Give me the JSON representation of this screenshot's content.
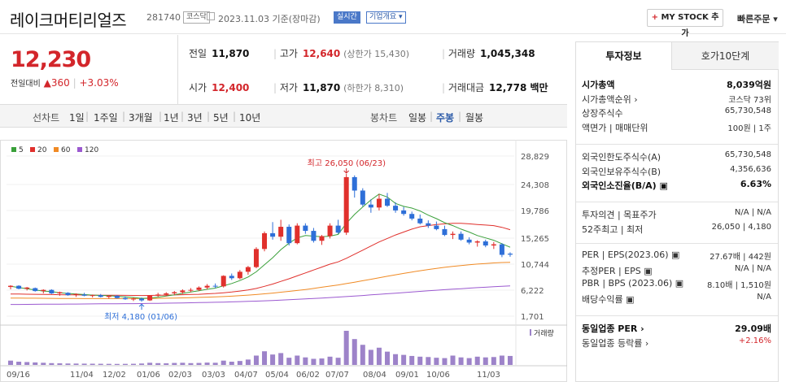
{
  "header": {
    "name": "레이크머티리얼즈",
    "code": "281740",
    "market": "코스닥",
    "date": "2023.11.03 기준(장마감)",
    "live": "실시간",
    "info": "기업개요 ▾",
    "mystock": "MY STOCK 추가",
    "quick_order": "빠른주문 ▾"
  },
  "price": {
    "current": "12,230",
    "diff_label": "전일대비",
    "diff": "▲360",
    "pct": "+3.03%",
    "prev_label": "전일",
    "prev": "11,870",
    "high_label": "고가",
    "high": "12,640",
    "high_limit": "(상한가 15,430)",
    "volume_label": "거래량",
    "volume": "1,045,348",
    "open_label": "시가",
    "open": "12,400",
    "low_label": "저가",
    "low": "11,870",
    "low_limit": "(하한가 8,310)",
    "amount_label": "거래대금",
    "amount": "12,778 백만"
  },
  "periods": {
    "line_label": "선차트",
    "line": [
      "1일",
      "1주일",
      "3개월",
      "1년",
      "3년",
      "5년",
      "10년"
    ],
    "candle_label": "봉차트",
    "candle": [
      "일봉",
      "주봉",
      "월봉"
    ],
    "selected": "주봉"
  },
  "chart_data": {
    "type": "candlestick",
    "legend": [
      "5",
      "20",
      "60",
      "120"
    ],
    "legend_colors": [
      "#3aa03a",
      "#e0302c",
      "#f08a24",
      "#9b59d0"
    ],
    "y_ticks": [
      "28,829",
      "24,308",
      "19,786",
      "15,265",
      "10,744",
      "6,222",
      "1,701"
    ],
    "x_ticks": [
      "09/16",
      "11/04",
      "12/02",
      "01/06",
      "02/03",
      "03/03",
      "04/07",
      "05/04",
      "06/02",
      "07/07",
      "08/04",
      "09/01",
      "10/06",
      "11/03"
    ],
    "high_note": "최고 26,050 (06/23)",
    "low_note": "최저 4,180 (01/06)",
    "volume_label": "거래량",
    "y_range": [
      1701,
      28829
    ],
    "candles": [
      [
        6700,
        7000,
        6300,
        6900
      ],
      [
        6900,
        7000,
        6300,
        6400
      ],
      [
        6400,
        6700,
        6100,
        6600
      ],
      [
        6500,
        6600,
        5900,
        6000
      ],
      [
        6000,
        6300,
        5600,
        6200
      ],
      [
        6200,
        6300,
        5500,
        5600
      ],
      [
        5600,
        5900,
        5200,
        5800
      ],
      [
        5700,
        5800,
        5200,
        5300
      ],
      [
        5300,
        5600,
        5000,
        5500
      ],
      [
        5400,
        5700,
        5100,
        5200
      ],
      [
        5200,
        5400,
        4900,
        5300
      ],
      [
        5300,
        5500,
        4900,
        5000
      ],
      [
        5000,
        5300,
        4700,
        5200
      ],
      [
        5200,
        5300,
        4700,
        4800
      ],
      [
        4800,
        5100,
        4500,
        4600
      ],
      [
        4600,
        4900,
        4300,
        4700
      ],
      [
        4700,
        4900,
        4180,
        4400
      ],
      [
        4400,
        5300,
        4300,
        5200
      ],
      [
        5200,
        5700,
        5000,
        5400
      ],
      [
        5400,
        5800,
        5100,
        5600
      ],
      [
        5600,
        6000,
        5300,
        5800
      ],
      [
        5800,
        6300,
        5500,
        6100
      ],
      [
        6100,
        6500,
        5800,
        6200
      ],
      [
        6200,
        6800,
        6000,
        6600
      ],
      [
        6600,
        7200,
        6300,
        6900
      ],
      [
        6900,
        7300,
        6500,
        6800
      ],
      [
        6800,
        8700,
        6600,
        8600
      ],
      [
        8600,
        9000,
        7900,
        8200
      ],
      [
        8200,
        9600,
        8000,
        9300
      ],
      [
        9300,
        10300,
        8800,
        10100
      ],
      [
        10100,
        13500,
        9900,
        13200
      ],
      [
        13200,
        16200,
        12800,
        15900
      ],
      [
        15900,
        17800,
        14800,
        15300
      ],
      [
        15300,
        18200,
        14600,
        17000
      ],
      [
        17000,
        17400,
        13800,
        14200
      ],
      [
        14200,
        17600,
        14000,
        17200
      ],
      [
        17200,
        17600,
        15800,
        16300
      ],
      [
        16300,
        16800,
        14300,
        14600
      ],
      [
        14600,
        15600,
        13900,
        15400
      ],
      [
        15400,
        17600,
        15000,
        17200
      ],
      [
        17200,
        18200,
        15800,
        16000
      ],
      [
        16000,
        26050,
        15600,
        25500
      ],
      [
        25500,
        25800,
        22000,
        23200
      ],
      [
        23200,
        23600,
        20500,
        20800
      ],
      [
        20800,
        21700,
        19400,
        20300
      ],
      [
        20300,
        22600,
        19800,
        21800
      ],
      [
        21800,
        22800,
        20400,
        20600
      ],
      [
        20600,
        21200,
        19400,
        19800
      ],
      [
        19800,
        20400,
        18900,
        19200
      ],
      [
        19200,
        19600,
        18100,
        18400
      ],
      [
        18400,
        19100,
        17400,
        17600
      ],
      [
        17600,
        18100,
        16800,
        17200
      ],
      [
        17200,
        17900,
        16400,
        16600
      ],
      [
        16600,
        17200,
        15400,
        15600
      ],
      [
        15600,
        16200,
        14900,
        15800
      ],
      [
        15800,
        16200,
        14600,
        14800
      ],
      [
        14800,
        15200,
        14000,
        14300
      ],
      [
        14300,
        14700,
        13600,
        14500
      ],
      [
        14500,
        14800,
        13500,
        13800
      ],
      [
        13800,
        14400,
        13200,
        14000
      ],
      [
        14000,
        14200,
        11800,
        12200
      ],
      [
        12400,
        12640,
        11870,
        12230
      ]
    ],
    "ma5": [
      6800,
      6600,
      6400,
      6200,
      6000,
      5900,
      5700,
      5600,
      5500,
      5400,
      5300,
      5250,
      5200,
      5100,
      5000,
      4900,
      4750,
      4800,
      4950,
      5150,
      5350,
      5600,
      5850,
      6050,
      6300,
      6500,
      6900,
      7300,
      7800,
      8400,
      9300,
      10500,
      11700,
      13100,
      14200,
      15100,
      15500,
      15400,
      15300,
      15400,
      15700,
      17600,
      19100,
      20400,
      21600,
      22600,
      22100,
      21000,
      20500,
      20200,
      19700,
      19000,
      18400,
      17700,
      17200,
      16600,
      16100,
      15500,
      15100,
      14700,
      14100,
      13500
    ],
    "ma20": [
      5500,
      5480,
      5460,
      5440,
      5420,
      5400,
      5380,
      5360,
      5340,
      5320,
      5300,
      5290,
      5280,
      5270,
      5260,
      5250,
      5240,
      5250,
      5270,
      5300,
      5330,
      5370,
      5410,
      5450,
      5520,
      5600,
      5710,
      5830,
      6000,
      6200,
      6450,
      6800,
      7200,
      7650,
      8100,
      8600,
      9100,
      9600,
      10100,
      10600,
      11000,
      11600,
      12300,
      13000,
      13700,
      14400,
      15000,
      15600,
      16100,
      16600,
      17000,
      17200,
      17400,
      17500,
      17600,
      17600,
      17500,
      17400,
      17300,
      17200,
      16900,
      16500
    ],
    "ma60": [
      4800,
      4790,
      4780,
      4770,
      4760,
      4750,
      4740,
      4730,
      4720,
      4710,
      4700,
      4700,
      4700,
      4700,
      4700,
      4710,
      4720,
      4730,
      4750,
      4770,
      4800,
      4830,
      4870,
      4910,
      4950,
      5000,
      5060,
      5130,
      5210,
      5300,
      5400,
      5520,
      5650,
      5800,
      5950,
      6100,
      6270,
      6450,
      6650,
      6850,
      7050,
      7280,
      7520,
      7770,
      8020,
      8280,
      8530,
      8780,
      9020,
      9260,
      9480,
      9690,
      9880,
      10060,
      10220,
      10370,
      10500,
      10620,
      10720,
      10810,
      10880,
      10930
    ],
    "ma120": [
      3700,
      3710,
      3720,
      3730,
      3740,
      3750,
      3760,
      3770,
      3780,
      3790,
      3800,
      3810,
      3820,
      3830,
      3840,
      3850,
      3860,
      3880,
      3900,
      3920,
      3940,
      3960,
      3990,
      4020,
      4050,
      4080,
      4110,
      4150,
      4190,
      4230,
      4280,
      4330,
      4390,
      4450,
      4510,
      4580,
      4650,
      4730,
      4810,
      4890,
      4970,
      5060,
      5150,
      5240,
      5340,
      5440,
      5540,
      5640,
      5740,
      5840,
      5940,
      6040,
      6140,
      6230,
      6320,
      6410,
      6500,
      6580,
      6660,
      6740,
      6810,
      6880
    ],
    "volumes": [
      120,
      90,
      80,
      70,
      60,
      50,
      45,
      40,
      38,
      36,
      34,
      32,
      30,
      28,
      30,
      32,
      40,
      60,
      50,
      45,
      55,
      60,
      50,
      55,
      65,
      60,
      120,
      90,
      110,
      150,
      260,
      380,
      290,
      330,
      200,
      260,
      210,
      170,
      180,
      230,
      200,
      950,
      720,
      560,
      420,
      480,
      370,
      300,
      280,
      250,
      230,
      220,
      200,
      190,
      260,
      210,
      190,
      230,
      210,
      220,
      260,
      250
    ]
  },
  "right": {
    "tabs": [
      "투자정보",
      "호가10단계"
    ],
    "rows1": [
      {
        "l": "시가총액",
        "r": "8,039억원",
        "bold": true
      },
      {
        "l": "시가총액순위 ›",
        "r": "코스닥 73위"
      },
      {
        "l": "상장주식수",
        "r": "65,730,548"
      },
      {
        "l": "액면가 | 매매단위",
        "r": "100원 | 1주"
      }
    ],
    "rows2": [
      {
        "l": "외국인한도주식수(A)",
        "r": "65,730,548"
      },
      {
        "l": "외국인보유주식수(B)",
        "r": "4,356,636"
      },
      {
        "l": "외국인소진율(B/A) ▣",
        "r": "6.63%",
        "bold": true
      }
    ],
    "rows3": [
      {
        "l": "투자의견 | 목표주가",
        "r": "N/A | N/A"
      },
      {
        "l": "52주최고 | 최저",
        "r": "26,050 | 4,180"
      }
    ],
    "rows4": [
      {
        "l": "PER | EPS(2023.06) ▣",
        "r": "27.67배 | 442원"
      },
      {
        "l": "추정PER | EPS ▣",
        "r": "N/A | N/A"
      },
      {
        "l": "PBR | BPS (2023.06) ▣",
        "r": "8.10배 | 1,510원"
      },
      {
        "l": "배당수익률 ▣",
        "r": "N/A"
      }
    ],
    "rows5": [
      {
        "l": "동일업종 PER ›",
        "r": "29.09배",
        "bold": true
      },
      {
        "l": "동일업종 등락률 ›",
        "r": "+2.16%",
        "red": true
      }
    ]
  }
}
